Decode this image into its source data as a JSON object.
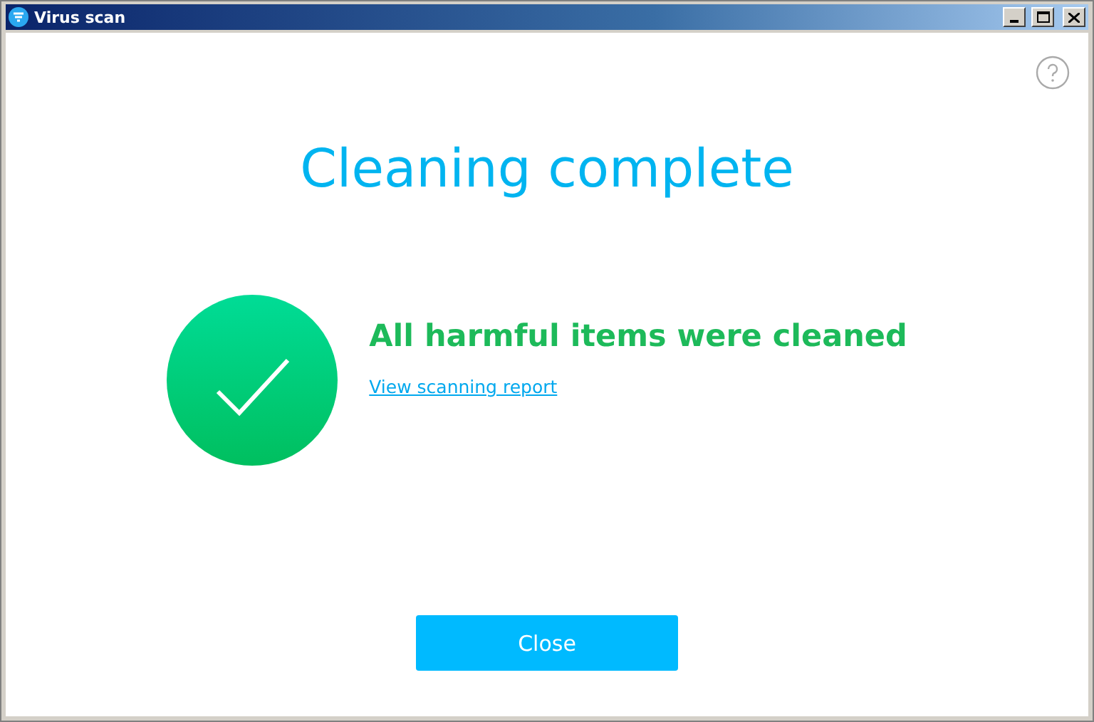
{
  "window": {
    "title": "Virus scan"
  },
  "heading": "Cleaning complete",
  "result": {
    "message": "All harmful items were cleaned",
    "link": "View scanning report"
  },
  "buttons": [
    "Close"
  ]
}
